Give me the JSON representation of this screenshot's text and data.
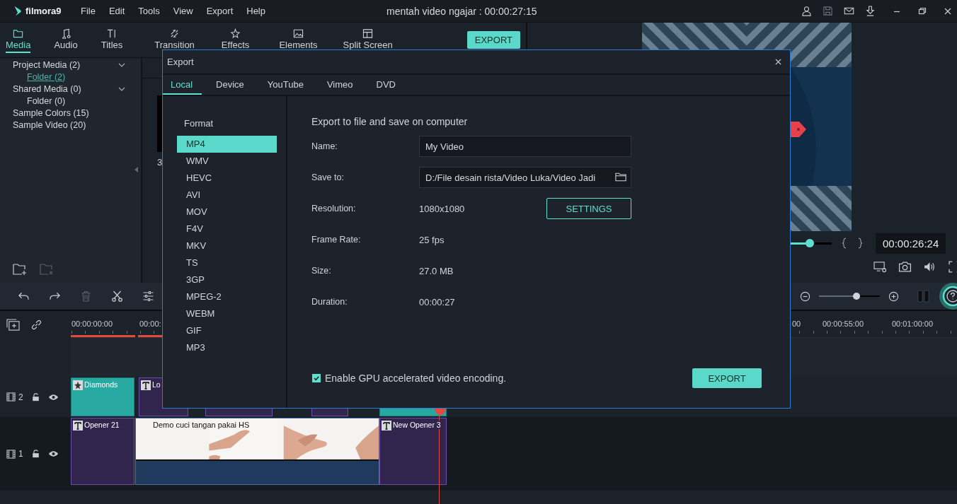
{
  "app": {
    "logo": "filmora9",
    "menu": [
      "File",
      "Edit",
      "Tools",
      "View",
      "Export",
      "Help"
    ],
    "title": "mentah video ngajar : 00:00:27:15"
  },
  "media_tabs": [
    {
      "label": "Media",
      "selected": true
    },
    {
      "label": "Audio",
      "selected": false
    },
    {
      "label": "Titles",
      "selected": false
    },
    {
      "label": "Transition",
      "selected": false
    },
    {
      "label": "Effects",
      "selected": false
    },
    {
      "label": "Elements",
      "selected": false
    },
    {
      "label": "Split Screen",
      "selected": false
    }
  ],
  "export_button": "EXPORT",
  "library": [
    {
      "label": "Project Media (2)",
      "expanded": true,
      "children": [
        {
          "label": "Folder (2)",
          "selected": true
        }
      ]
    },
    {
      "label": "Shared Media (0)",
      "expanded": true,
      "children": [
        {
          "label": "Folder (0)",
          "selected": false
        }
      ]
    },
    {
      "label": "Sample Colors (15)"
    },
    {
      "label": "Sample Video (20)"
    }
  ],
  "media_items": [
    {
      "label": "3"
    }
  ],
  "preview": {
    "level": 0.93,
    "timecode": "00:00:26:24"
  },
  "timeline": {
    "zoom": {
      "level": 0.62
    },
    "ruler": [
      "00:00:00:00",
      "00:00:",
      "00",
      "00:00:55:00",
      "00:01:00:00"
    ],
    "tracks": [
      {
        "number": "2",
        "clips": [
          {
            "kind": "effect",
            "label": "Diamonds"
          },
          {
            "kind": "title",
            "label": "Lo"
          },
          {
            "kind": "title"
          },
          {
            "kind": "title"
          },
          {
            "kind": "effect"
          }
        ]
      },
      {
        "number": "1",
        "clips": [
          {
            "kind": "title",
            "label": "Opener 21"
          },
          {
            "kind": "video",
            "label": "Demo cuci tangan pakai HS"
          },
          {
            "kind": "title",
            "label": "New Opener 3"
          }
        ]
      }
    ]
  },
  "dialog": {
    "title": "Export",
    "tabs": [
      {
        "label": "Local",
        "selected": true
      },
      {
        "label": "Device",
        "selected": false
      },
      {
        "label": "YouTube",
        "selected": false
      },
      {
        "label": "Vimeo",
        "selected": false
      },
      {
        "label": "DVD",
        "selected": false
      }
    ],
    "format_label": "Format",
    "formats": [
      {
        "label": "MP4",
        "selected": true
      },
      {
        "label": "WMV",
        "selected": false
      },
      {
        "label": "HEVC",
        "selected": false
      },
      {
        "label": "AVI",
        "selected": false
      },
      {
        "label": "MOV",
        "selected": false
      },
      {
        "label": "F4V",
        "selected": false
      },
      {
        "label": "MKV",
        "selected": false
      },
      {
        "label": "TS",
        "selected": false
      },
      {
        "label": "3GP",
        "selected": false
      },
      {
        "label": "MPEG-2",
        "selected": false
      },
      {
        "label": "WEBM",
        "selected": false
      },
      {
        "label": "GIF",
        "selected": false
      },
      {
        "label": "MP3",
        "selected": false
      }
    ],
    "heading": "Export to file and save on computer",
    "rows": [
      {
        "kind": "input",
        "label": "Name:",
        "value": "My Video"
      },
      {
        "kind": "path",
        "label": "Save to:",
        "value": "D:/File desain rista/Video Luka/Video Jadi"
      },
      {
        "kind": "button",
        "label": "Resolution:",
        "value": "1080x1080",
        "button": "SETTINGS"
      },
      {
        "kind": "text",
        "label": "Frame Rate:",
        "value": "25 fps"
      },
      {
        "kind": "text",
        "label": "Size:",
        "value": "27.0 MB"
      },
      {
        "kind": "text",
        "label": "Duration:",
        "value": "00:00:27"
      }
    ],
    "gpu": {
      "label": "Enable GPU accelerated video encoding.",
      "checked": true
    },
    "export_button": "EXPORT"
  }
}
